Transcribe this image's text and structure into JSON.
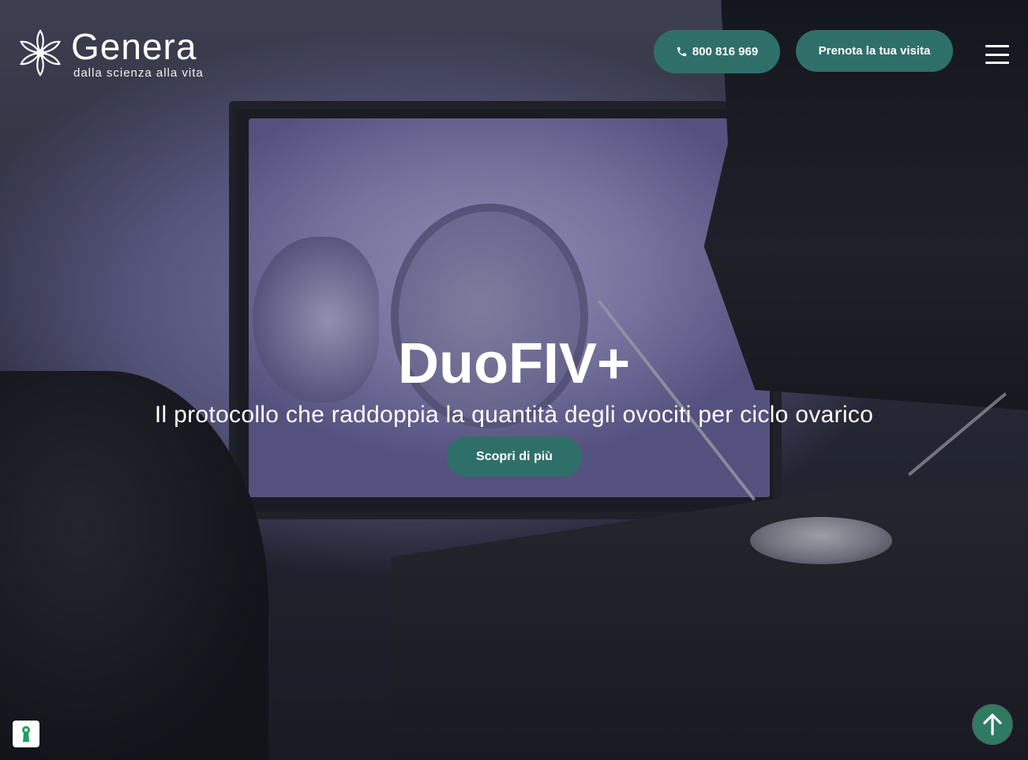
{
  "brand": {
    "name": "Genera",
    "tagline": "dalla scienza alla vita"
  },
  "header": {
    "phone_label": "800 816 969",
    "book_label": "Prenota la tua visita"
  },
  "hero": {
    "title": "DuoFIV+",
    "subtitle": "Il protocollo che raddoppia la quantità degli ovociti per ciclo ovarico",
    "cta_label": "Scopri di più"
  },
  "icons": {
    "logo": "flower-logo-icon",
    "phone": "phone-icon",
    "menu": "hamburger-menu-icon",
    "cookie": "keyhole-icon",
    "scroll_top": "arrow-up-icon"
  },
  "colors": {
    "accent": "#2f6f6a",
    "scroll_top": "#2f7a63",
    "cookie_icon": "#1aa35f",
    "text": "#ffffff"
  }
}
